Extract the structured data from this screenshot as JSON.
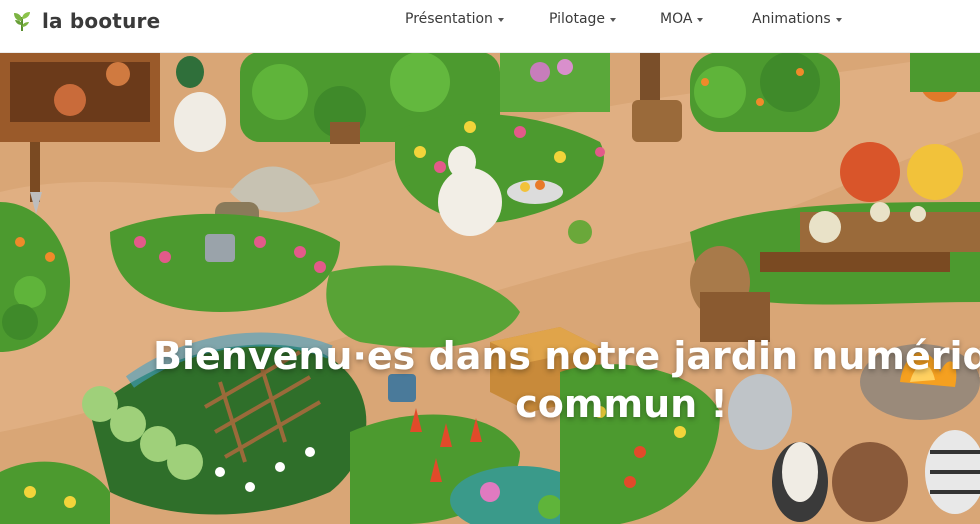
{
  "header": {
    "brand": {
      "name": "la booture",
      "icon": "sprout-leaf-icon"
    },
    "nav": [
      {
        "label": "Présentation"
      },
      {
        "label": "Pilotage"
      },
      {
        "label": "MOA"
      },
      {
        "label": "Animations"
      }
    ]
  },
  "hero": {
    "title_line1": "Bienvenu·es dans notre jardin numérique",
    "title_line2": "commun !"
  },
  "colors": {
    "path": "#d9a676",
    "foliage": "#4c9a2f",
    "header_text": "#3a3a3a"
  }
}
